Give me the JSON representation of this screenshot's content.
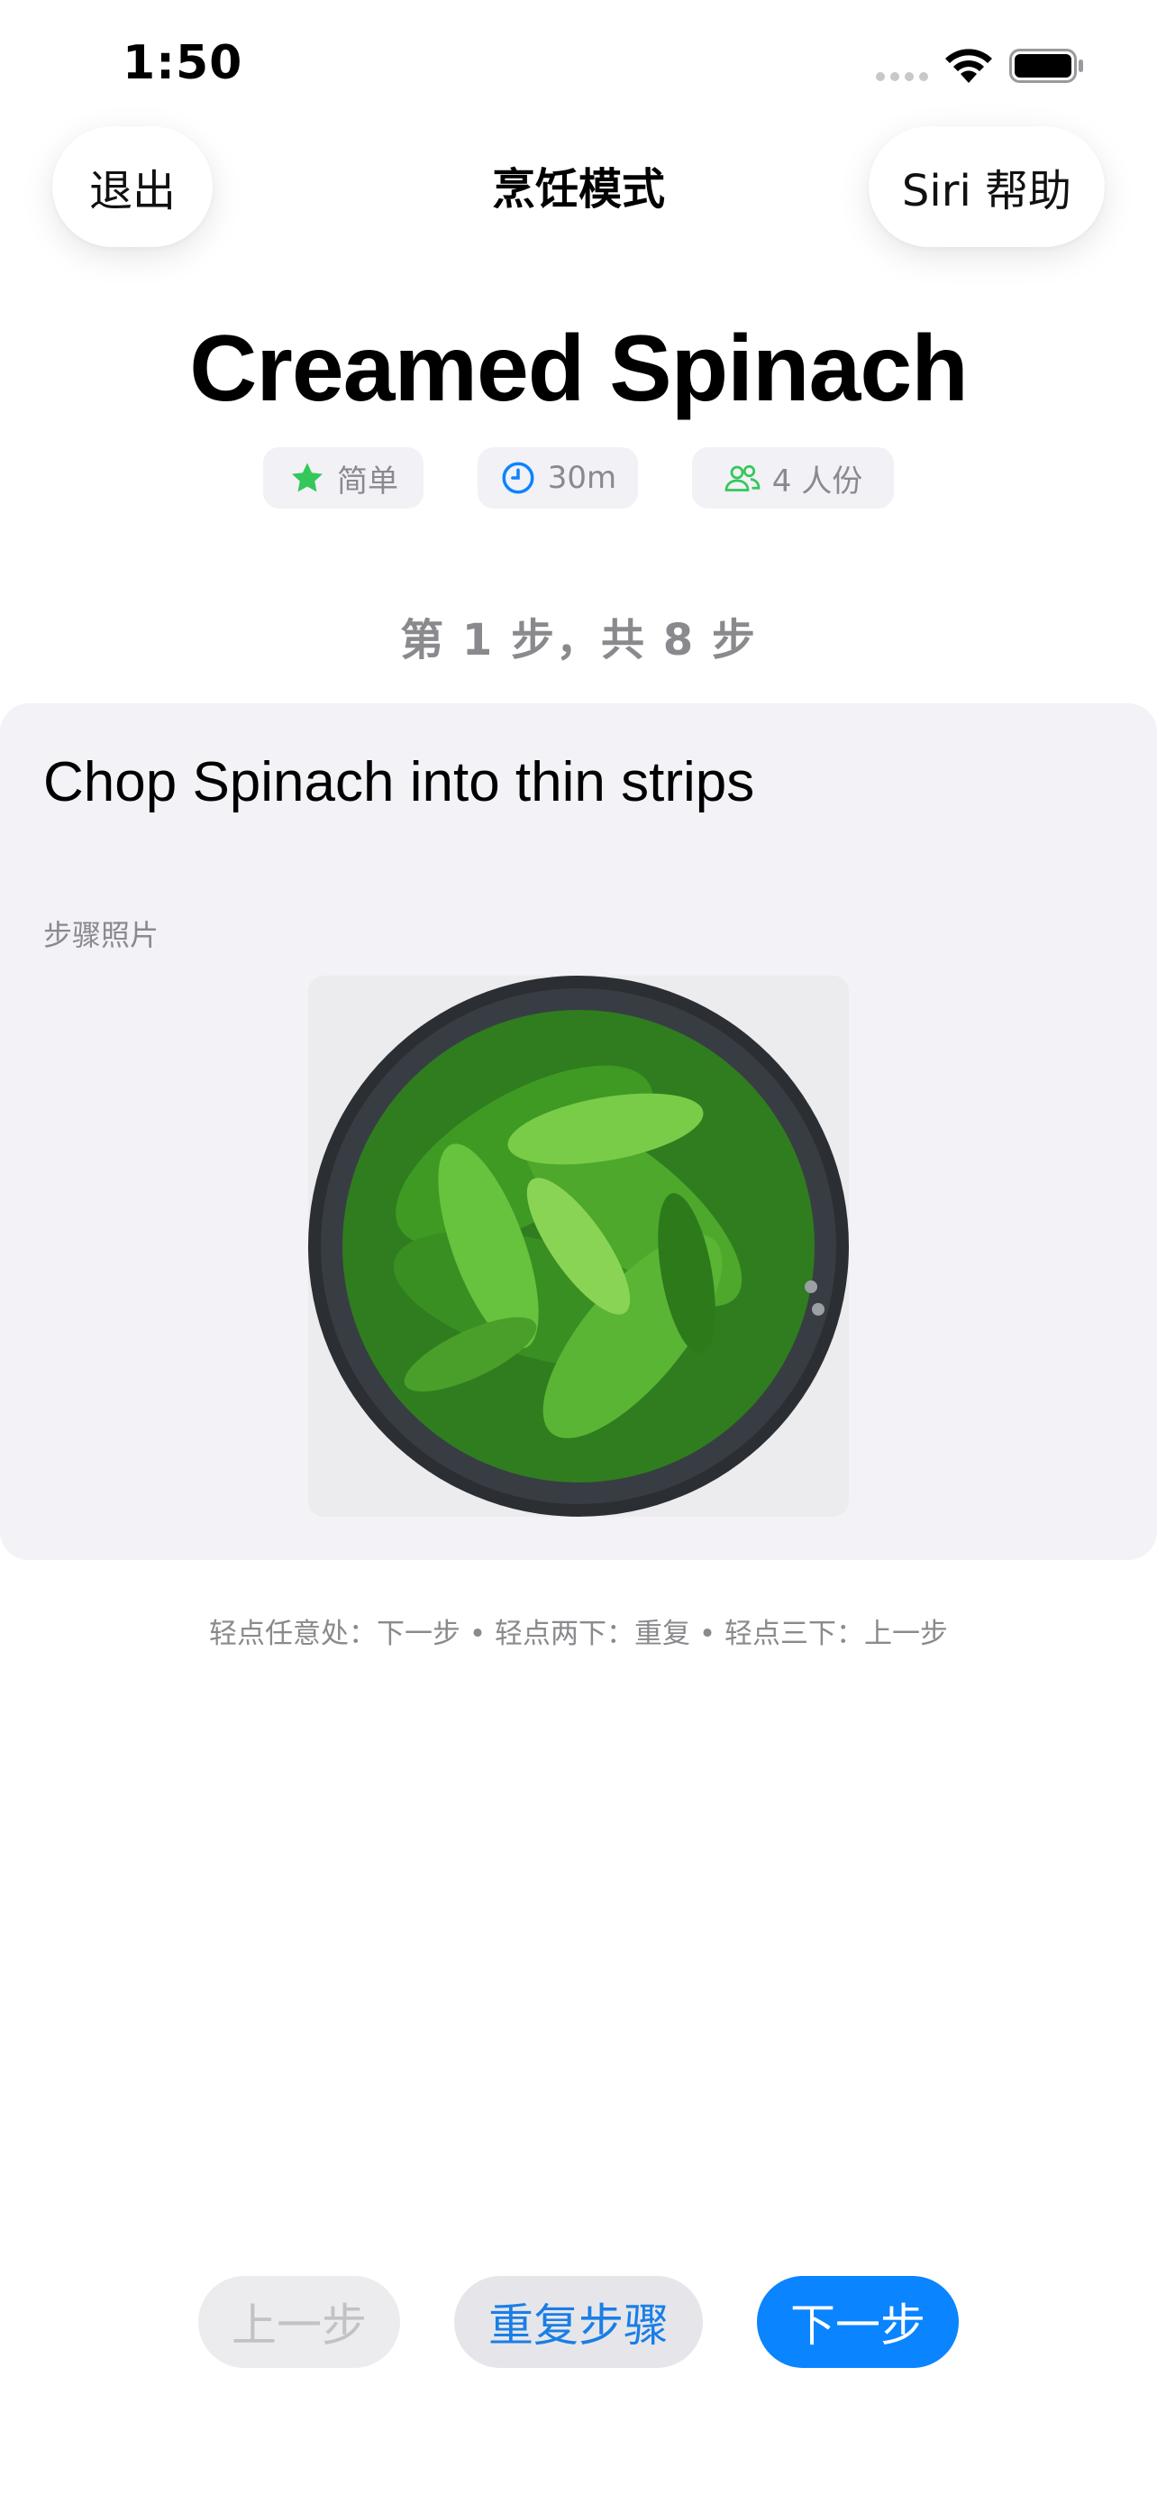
{
  "status": {
    "time": "1:50"
  },
  "nav": {
    "exit_label": "退出",
    "title": "烹饪模式",
    "siri_label": "Siri 帮助"
  },
  "recipe": {
    "title": "Creamed Spinach",
    "difficulty": "简单",
    "time": "30m",
    "servings": "4 人份"
  },
  "step": {
    "indicator": "第 1 步，共 8 步",
    "text": "Chop Spinach into thin strips",
    "photo_label": "步骤照片"
  },
  "hint": "轻点任意处：下一步 • 轻点两下：重复 • 轻点三下：上一步",
  "controls": {
    "prev_label": "上一步",
    "repeat_label": "重复步骤",
    "next_label": "下一步"
  },
  "colors": {
    "accent": "#0A84FF",
    "star": "#34C759",
    "time_icon": "#0A84FF",
    "people_icon": "#34C759",
    "card_bg": "#F2F2F7"
  }
}
